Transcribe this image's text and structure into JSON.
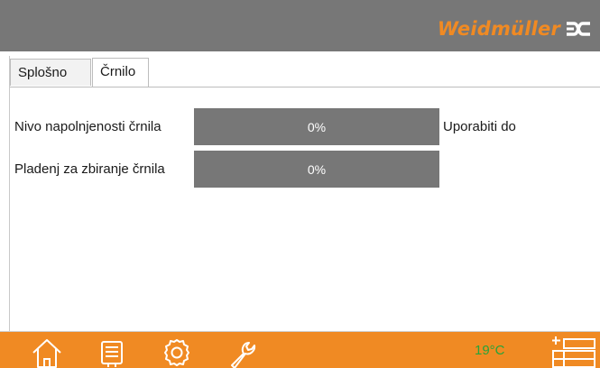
{
  "header": {
    "brand": "Weidmüller",
    "logo_icon": "weidmuller-logo-icon"
  },
  "tabs": [
    {
      "label": "Splošno",
      "active": false
    },
    {
      "label": "Črnilo",
      "active": true
    }
  ],
  "ink": {
    "rows": [
      {
        "label": "Nivo napolnjenosti črnila",
        "value": "0%",
        "fill_fraction": 0
      },
      {
        "label": "Pladenj za zbiranje črnila",
        "value": "0%",
        "fill_fraction": 0
      }
    ],
    "use_until_label": "Uporabiti do"
  },
  "footer": {
    "icons": [
      "home-icon",
      "keyboard-icon",
      "gear-icon",
      "wrench-icon",
      "grid-menu-icon"
    ],
    "temperature": "19°C"
  },
  "colors": {
    "accent": "#f08a23",
    "header": "#777777",
    "bar": "#777777",
    "temperature": "#27a43a"
  }
}
